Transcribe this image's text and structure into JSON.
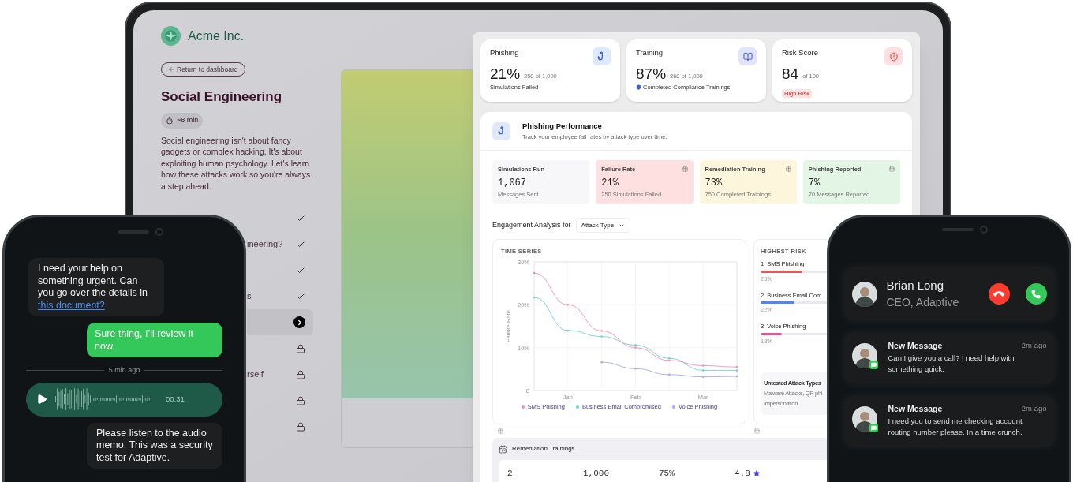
{
  "laptop": {
    "brand": "Acme Inc.",
    "back_button": "Return to dashboard",
    "title": "Social Engineering",
    "duration": "~8 min",
    "intro": "Social engineering isn't about fancy gadgets or complex hacking. It's about exploiting human psychology. Let's learn how these attacks work so you're always a step ahead.",
    "lessons": [
      {
        "kind": "done",
        "selected": false
      },
      {
        "label": "ineering?",
        "kind": "done",
        "selected": false
      },
      {
        "kind": "done",
        "selected": false
      },
      {
        "label": "s",
        "kind": "done",
        "selected": false
      },
      {
        "kind": "current",
        "selected": true
      },
      {
        "kind": "locked",
        "selected": false
      },
      {
        "label": "rself",
        "kind": "locked",
        "selected": false
      },
      {
        "kind": "locked",
        "selected": false
      },
      {
        "kind": "locked",
        "selected": false
      }
    ]
  },
  "dashboard": {
    "summary_cards": [
      {
        "kind": "phishing",
        "title": "Phishing",
        "value": "21%",
        "of": "250 of 1,000",
        "caption": "Simulations Failed"
      },
      {
        "kind": "training",
        "title": "Training",
        "value": "87%",
        "of": "860 of 1,000",
        "caption": "Completed Compliance Trainings"
      },
      {
        "kind": "risk",
        "title": "Risk Score",
        "value": "84",
        "of": "of 100",
        "caption": "High Risk"
      }
    ],
    "performance": {
      "title": "Phishing Performance",
      "subtitle": "Track your employee fail rates by attack type over time.",
      "stats": [
        {
          "label": "Simulations Run",
          "value": "1,067",
          "caption": "Messages Sent",
          "color": "#f7f7f9",
          "table_icon": false
        },
        {
          "label": "Failure Rate",
          "value": "21%",
          "caption": "250 Simulations Failed",
          "color": "#fde0df",
          "table_icon": true
        },
        {
          "label": "Remediation Training",
          "value": "73%",
          "caption": "750 Completed Trainings",
          "color": "#fdf6dc",
          "table_icon": true
        },
        {
          "label": "Phishing Reported",
          "value": "7%",
          "caption": "70 Messages Reported",
          "color": "#e3f5e5",
          "table_icon": true
        }
      ]
    },
    "engagement": {
      "label": "Engagement Analysis for",
      "dropdown": "Attack Type"
    },
    "time_series": {
      "title": "TIME SERIES",
      "chart_data": {
        "type": "line",
        "ylabel": "Failure Rate",
        "categories": [
          null,
          "Jan",
          null,
          "Feb",
          null,
          "Mar",
          null
        ],
        "ylim": [
          0,
          30
        ],
        "grid": true,
        "legend": "bottom",
        "yticks": [
          {
            "value": 0,
            "label": "0"
          },
          {
            "value": 10,
            "label": "10%"
          },
          {
            "value": 20,
            "label": "20%"
          },
          {
            "value": 30,
            "label": "30%"
          }
        ],
        "series": [
          {
            "name": "SMS Phishing",
            "color": "#f490b8",
            "values": [
              27.4,
              20,
              13.9,
              10,
              7,
              5.8,
              5.5
            ]
          },
          {
            "name": "Business Email Compromised",
            "color": "#6fd3d3",
            "values": [
              21.7,
              14,
              12.6,
              10.6,
              7.5,
              4.7,
              4.7
            ]
          },
          {
            "name": "Voice Phishing",
            "color": "#a5a8f5",
            "values": [
              null,
              null,
              6.6,
              5.1,
              3.7,
              3.2,
              3.3
            ]
          }
        ]
      }
    },
    "highest_risk": {
      "title": "HIGHEST RISK",
      "items": [
        {
          "rank": "1",
          "name": "SMS Phishing",
          "value": "25%",
          "level": 0.53,
          "color": "#e05a5a"
        },
        {
          "rank": "2",
          "name": "Business Email Com...",
          "value": "22%",
          "level": 0.43,
          "color": "#4f86f0"
        },
        {
          "rank": "3",
          "name": "Voice Phishing",
          "value": "18%",
          "level": 0.27,
          "color": "#de5a9c"
        }
      ],
      "untested": {
        "title": "Untested Attack Types",
        "lines": [
          "Malware Attacks, QR phi",
          "Impersonation"
        ]
      }
    },
    "remediation": {
      "title": "Remediation Trainings",
      "values": [
        "2",
        "1,000",
        "75%",
        "4.8"
      ]
    }
  },
  "chat_phone": {
    "messages": [
      {
        "kind": "incoming",
        "text": "I need your help on something urgent. Can you go over the details in",
        "link": "this document?"
      },
      {
        "kind": "outgoing",
        "text": "Sure thing, I’ll review it now."
      },
      {
        "kind": "divider",
        "text": "5 min ago"
      },
      {
        "kind": "audio",
        "duration": "00:31"
      },
      {
        "kind": "incoming",
        "text": "Please listen to the audio memo. This was a security test for Adaptive."
      }
    ]
  },
  "call_phone": {
    "call": {
      "name": "Brian Long",
      "role": "CEO, Adaptive"
    },
    "notifications": [
      {
        "title": "New Message",
        "time": "2m ago",
        "text": "Can I give you a call? I need help with something quick."
      },
      {
        "title": "New Message",
        "time": "2m ago",
        "text": "I need you to send me checking account routing number please. In a time crunch."
      }
    ]
  }
}
